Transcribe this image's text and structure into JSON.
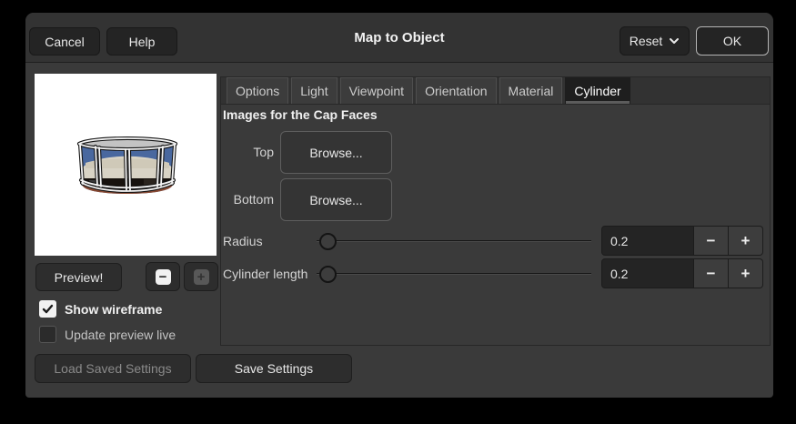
{
  "titlebar": {
    "cancel_label": "Cancel",
    "help_label": "Help",
    "title": "Map to Object",
    "reset_label": "Reset",
    "ok_label": "OK"
  },
  "tabs": [
    {
      "label": "Options",
      "active": false
    },
    {
      "label": "Light",
      "active": false
    },
    {
      "label": "Viewpoint",
      "active": false
    },
    {
      "label": "Orientation",
      "active": false
    },
    {
      "label": "Material",
      "active": false
    },
    {
      "label": "Cylinder",
      "active": true
    }
  ],
  "panel": {
    "heading": "Images for the Cap Faces",
    "cap_rows": [
      {
        "label": "Top",
        "button": "Browse..."
      },
      {
        "label": "Bottom",
        "button": "Browse..."
      }
    ],
    "sliders": [
      {
        "label": "Radius",
        "value": "0.2"
      },
      {
        "label": "Cylinder length",
        "value": "0.2"
      }
    ],
    "spinner": {
      "minus": "−",
      "plus": "+"
    }
  },
  "preview": {
    "preview_button": "Preview!",
    "zoom_out_icon": "−",
    "zoom_in_icon": "+",
    "checkboxes": [
      {
        "label": "Show wireframe",
        "checked": true
      },
      {
        "label": "Update preview live",
        "checked": false
      }
    ]
  },
  "footer": {
    "load_label": "Load Saved Settings",
    "save_label": "Save Settings"
  },
  "colors": {
    "dialog_bg": "#3a3a3a",
    "titlebar_bg": "#333333",
    "button_bg": "#2d2d2d",
    "active_tab_bg": "#1e1e1e",
    "default_button_border": "#b4b4b4",
    "entry_bg": "#242424",
    "preview_sky": "#49689f",
    "preview_building": "#d8d3c5"
  }
}
